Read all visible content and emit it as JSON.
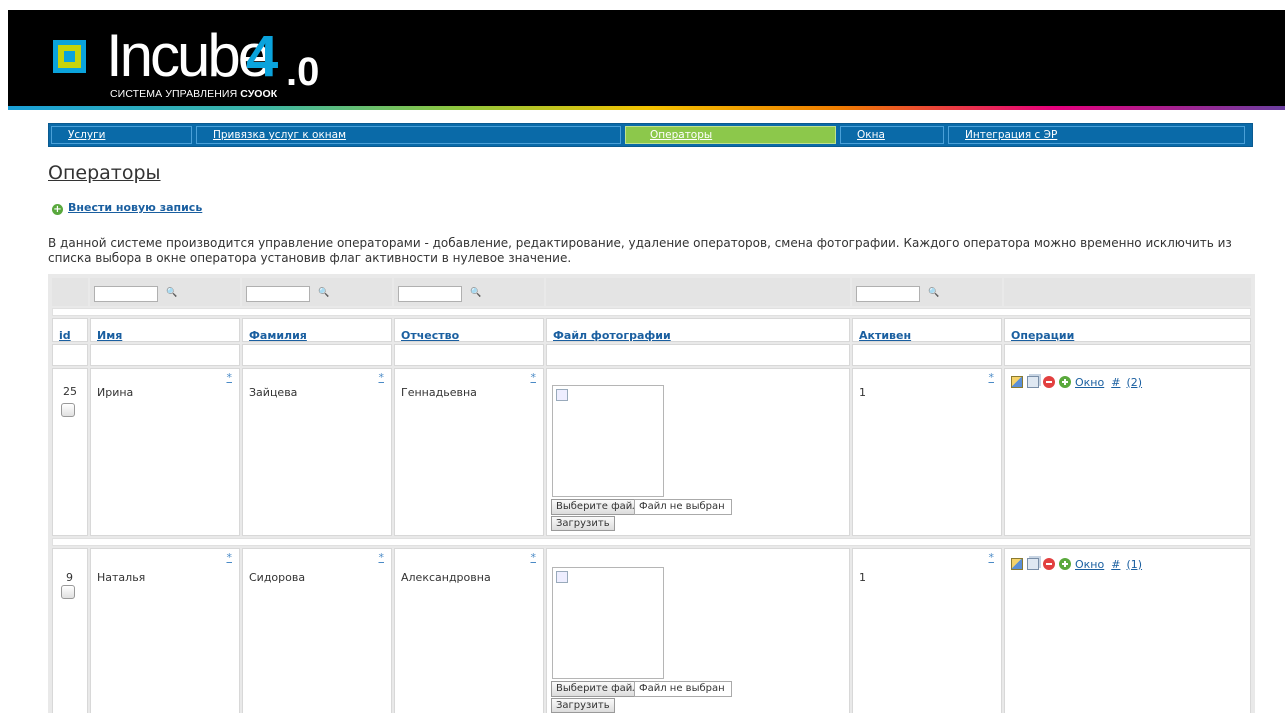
{
  "header": {
    "logo_word": "Incube",
    "logo_version_major": "4",
    "logo_version_minor": ".0",
    "logo_subtitle": "СИСТЕМА УПРАВЛЕНИЯ",
    "logo_subtitle_brand": "СУООК"
  },
  "nav": [
    {
      "label": "Услуги",
      "active": false
    },
    {
      "label": "Привязка услуг к окнам",
      "active": false
    },
    {
      "label": "Операторы",
      "active": true
    },
    {
      "label": "Окна",
      "active": false
    },
    {
      "label": "Интеграция с ЭР",
      "active": false
    }
  ],
  "page": {
    "title": "Операторы",
    "add_new": "Внести новую запись",
    "description": "В данной системе производится управление операторами - добавление, редактирование, удаление операторов, смена фотографии. Каждого оператора можно временно исключить из списка выбора в окне оператора установив флаг активности в нулевое значение."
  },
  "table": {
    "columns": [
      "id",
      "Имя",
      "Фамилия",
      "Отчество",
      "Файл фотографии",
      "Активен",
      "Операции"
    ],
    "edit_marker": "*",
    "file_button": "Выберите файл",
    "file_status": "Файл не выбран",
    "upload_button": "Загрузить",
    "op_window_link": "Окно",
    "op_hash": "#",
    "rows": [
      {
        "id": "25",
        "first_name": "Ирина",
        "last_name": "Зайцева",
        "patronymic": "Геннадьевна",
        "active": "1",
        "count": "(2)"
      },
      {
        "id": "9",
        "first_name": "Наталья",
        "last_name": "Сидорова",
        "patronymic": "Александровна",
        "active": "1",
        "count": "(1)"
      }
    ]
  },
  "icons": {
    "filter": "binoculars-icon",
    "add": "plus-circle-icon",
    "edit": "edit-icon",
    "copy": "copy-icon",
    "delete": "delete-icon",
    "add_op": "add-icon"
  },
  "colors": {
    "nav_bg": "#0a6aa8",
    "nav_active": "#8cc84b",
    "link": "#1a5fa0",
    "logo_accent": "#0aa3dc"
  }
}
